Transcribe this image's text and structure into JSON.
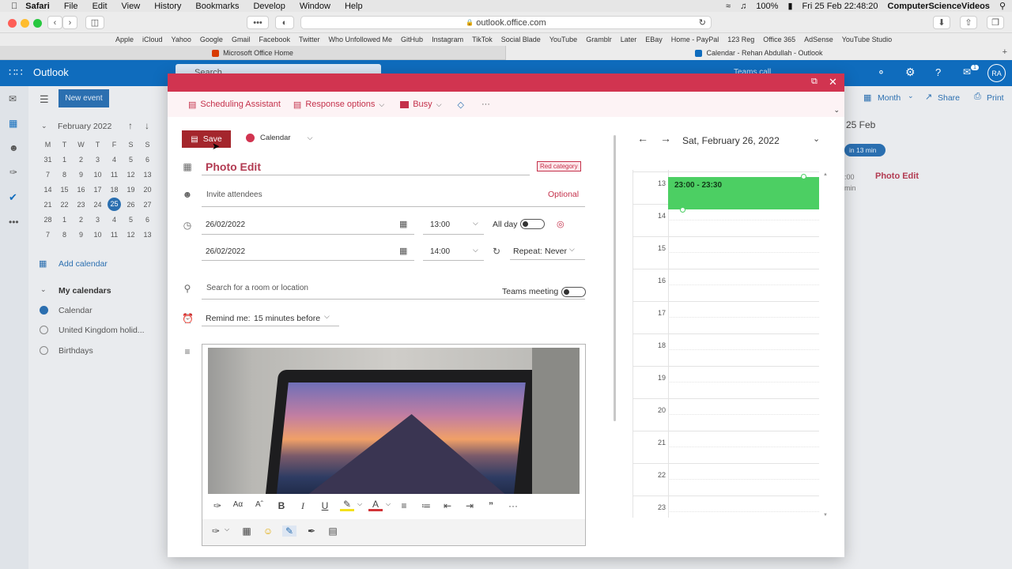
{
  "menubar": {
    "app": "Safari",
    "items": [
      "File",
      "Edit",
      "View",
      "History",
      "Bookmarks",
      "Develop",
      "Window",
      "Help"
    ],
    "battery": "100%",
    "datetime": "Fri 25 Feb  22:48:20",
    "user": "ComputerScienceVideos"
  },
  "safari": {
    "url": "outlook.office.com",
    "favorites": [
      "Apple",
      "iCloud",
      "Yahoo",
      "Google",
      "Gmail",
      "Facebook",
      "Twitter",
      "Who Unfollowed Me",
      "GitHub",
      "Instagram",
      "TikTok",
      "Social Blade",
      "YouTube",
      "Gramblr",
      "Later",
      "EBay",
      "Home - PayPal",
      "123 Reg",
      "Office 365",
      "AdSense",
      "YouTube Studio"
    ],
    "tabs": [
      "Microsoft Office Home",
      "Calendar - Rehan Abdullah - Outlook"
    ]
  },
  "outlook": {
    "app_name": "Outlook",
    "search_placeholder": "Search",
    "new_event": "New event",
    "avatar": "RA",
    "notif_count": "1",
    "month_label": "February 2022",
    "weekdays": [
      "M",
      "T",
      "W",
      "T",
      "F",
      "S",
      "S"
    ],
    "weeks": [
      [
        "31",
        "1",
        "2",
        "3",
        "4",
        "5",
        "6"
      ],
      [
        "7",
        "8",
        "9",
        "10",
        "11",
        "12",
        "13"
      ],
      [
        "14",
        "15",
        "16",
        "17",
        "18",
        "19",
        "20"
      ],
      [
        "21",
        "22",
        "23",
        "24",
        "25",
        "26",
        "27"
      ],
      [
        "28",
        "1",
        "2",
        "3",
        "4",
        "5",
        "6"
      ],
      [
        "7",
        "8",
        "9",
        "10",
        "11",
        "12",
        "13"
      ]
    ],
    "add_calendar": "Add calendar",
    "my_calendars": "My calendars",
    "calendars": [
      "Calendar",
      "United Kingdom holid...",
      "Birthdays"
    ],
    "view_month": "Month",
    "share": "Share",
    "print": "Print",
    "day_header": "25 Feb",
    "in_13_min": "in 13 min",
    "bg_time": ":00",
    "bg_min": "min",
    "bg_event": "Photo Edit",
    "teams_call": "Teams call"
  },
  "modal": {
    "commands": {
      "scheduling": "Scheduling Assistant",
      "response": "Response options",
      "busy": "Busy",
      "more": "···"
    },
    "save": "Save",
    "calendar": "Calendar",
    "title": "Photo Edit",
    "category": "Red category",
    "invite_placeholder": "Invite attendees",
    "optional": "Optional",
    "start_date": "26/02/2022",
    "start_time": "13:00",
    "all_day": "All day",
    "end_date": "26/02/2022",
    "end_time": "14:00",
    "repeat": "Repeat:",
    "repeat_value": "Never",
    "location_placeholder": "Search for a room or location",
    "teams_meeting": "Teams meeting",
    "remind": "Remind me:",
    "remind_value": "15 minutes before",
    "toolbar_more": "···",
    "quote": "”"
  },
  "dayview": {
    "date": "Sat, February 26, 2022",
    "hours": [
      "13",
      "14",
      "15",
      "16",
      "17",
      "18",
      "19",
      "20",
      "21",
      "22",
      "23"
    ],
    "event_time": "23:00 - 23:30",
    "event_color": "#4ccf63"
  },
  "colors": {
    "brand": "#0f6cbd",
    "modal_head": "#d13450",
    "save": "#a4262c"
  }
}
